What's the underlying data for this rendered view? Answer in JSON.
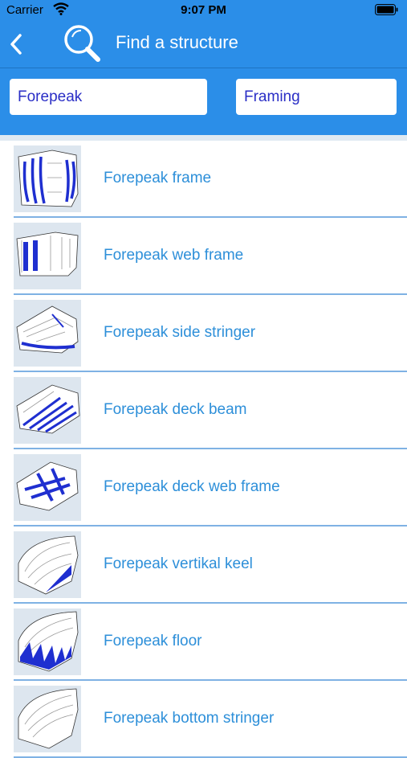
{
  "status": {
    "carrier": "Carrier",
    "time": "9:07 PM"
  },
  "nav": {
    "title": "Find a structure"
  },
  "filters": {
    "area": "Forepeak",
    "category": "Framing"
  },
  "items": [
    {
      "label": "Forepeak frame",
      "icon": "forepeak-frame-thumbnail"
    },
    {
      "label": "Forepeak web frame",
      "icon": "forepeak-web-frame-thumbnail"
    },
    {
      "label": "Forepeak side stringer",
      "icon": "forepeak-side-stringer-thumbnail"
    },
    {
      "label": "Forepeak deck beam",
      "icon": "forepeak-deck-beam-thumbnail"
    },
    {
      "label": "Forepeak deck web frame",
      "icon": "forepeak-deck-web-frame-thumbnail"
    },
    {
      "label": "Forepeak vertikal keel",
      "icon": "forepeak-vertikal-keel-thumbnail"
    },
    {
      "label": "Forepeak floor",
      "icon": "forepeak-floor-thumbnail"
    },
    {
      "label": "Forepeak bottom stringer",
      "icon": "forepeak-bottom-stringer-thumbnail"
    }
  ],
  "colors": {
    "header": "#2b8ee8",
    "label": "#2d8fd9",
    "field_text": "#2a2ec6",
    "highlight": "#1f2fd0"
  }
}
